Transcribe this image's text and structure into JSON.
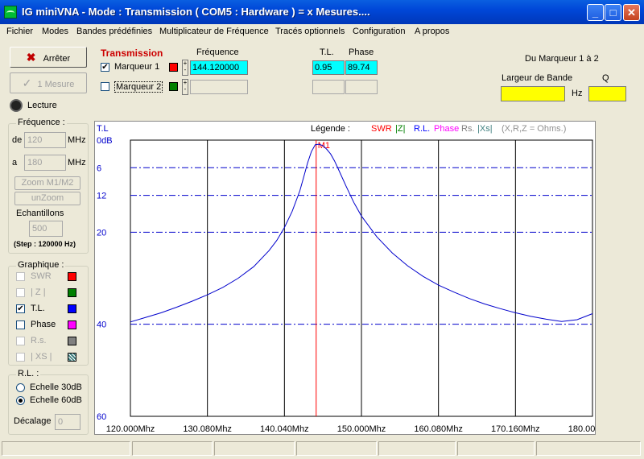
{
  "window": {
    "title": "IG miniVNA - Mode : Transmission ( COM5 :  Hardware ) = x Mesures....",
    "min": "_",
    "max": "□",
    "close": "✕"
  },
  "menu": [
    "Fichier",
    "Modes",
    "Bandes prédéfinies",
    "Multiplicateur de Fréquence",
    "Tracés optionnels",
    "Configuration",
    "A propos"
  ],
  "left": {
    "stop_label": "Arrêter",
    "one_measure_label": "1 Mesure",
    "read_label": "Lecture",
    "freq_group": "Fréquence :",
    "from_label": "de",
    "from_value": "120",
    "to_label": "a",
    "to_value": "180",
    "mhz": "MHz",
    "zoom_label": "Zoom M1/M2",
    "unzoom_label": "unZoom",
    "samples_label": "Echantillons",
    "samples_value": "500",
    "step_label": "(Step : 120000 Hz)",
    "graph_group": "Graphique :",
    "graphs": [
      {
        "label": "SWR",
        "checked": false,
        "enabled": false,
        "color": "#ff0000"
      },
      {
        "label": "| Z |",
        "checked": false,
        "enabled": false,
        "color": "#008000"
      },
      {
        "label": "T.L.",
        "checked": true,
        "enabled": true,
        "color": "#0000ff"
      },
      {
        "label": "Phase",
        "checked": false,
        "enabled": true,
        "color": "#ff00ff"
      },
      {
        "label": "R.s.",
        "checked": false,
        "enabled": false,
        "color": "#808080"
      },
      {
        "label": "| XS |",
        "checked": false,
        "enabled": false,
        "color": "#408080"
      }
    ],
    "rl_group": "R.L. :",
    "scale30": "Echelle 30dB",
    "scale60": "Echelle 60dB",
    "offset_label": "Décalage",
    "offset_value": "0"
  },
  "top": {
    "mode_title": "Transmission",
    "freq_header": "Fréquence",
    "tl_header": "T.L.",
    "phase_header": "Phase",
    "marker1_label": "Marqueur 1",
    "marker1_checked": true,
    "marker1_freq": "144.120000",
    "marker1_tl": "0.95",
    "marker1_phase": "89.74",
    "marker2_label": "Marqueur 2",
    "marker2_checked": false,
    "marker1_color": "#ff0000",
    "marker2_color": "#008000",
    "range_title": "Du Marqueur 1 à 2",
    "bandwidth_label": "Largeur de Bande",
    "hz_label": "Hz",
    "q_label": "Q",
    "spin_up": "+",
    "spin_down": "-"
  },
  "chart_data": {
    "type": "line",
    "ylabel": "T.L",
    "legend_label": "Légende :",
    "legend": [
      {
        "label": "SWR",
        "color": "#ff0000"
      },
      {
        "label": "|Z|",
        "color": "#008000"
      },
      {
        "label": "R.L.",
        "color": "#0000ff"
      },
      {
        "label": "Phase",
        "color": "#ff00ff"
      },
      {
        "label": "Rs.",
        "color": "#808080"
      },
      {
        "label": "|Xs|",
        "color": "#408080"
      },
      {
        "label": "(X,R,Z = Ohms.)",
        "color": "#909090"
      }
    ],
    "y_ticks": [
      {
        "label": "0dB",
        "value": 0
      },
      {
        "label": "6",
        "value": 6
      },
      {
        "label": "12",
        "value": 12
      },
      {
        "label": "20",
        "value": 20
      },
      {
        "label": "40",
        "value": 40
      },
      {
        "label": "60",
        "value": 60
      }
    ],
    "ylim": [
      0,
      60
    ],
    "x_ticks": [
      "120.000Mhz",
      "130.080Mhz",
      "140.040Mhz",
      "150.000Mhz",
      "160.080Mhz",
      "170.160Mhz",
      "180.000Mhz"
    ],
    "xlim": [
      120,
      180
    ],
    "grid": true,
    "marker": {
      "label": "M1",
      "x": 144.12,
      "color": "#ff0000"
    },
    "series": [
      {
        "color": "#0000cc",
        "x": [
          120,
          122,
          124,
          126,
          128,
          130,
          132,
          134,
          136,
          138,
          139,
          140,
          141,
          142,
          142.5,
          143,
          143.5,
          144,
          144.5,
          145,
          145.5,
          146,
          146.5,
          147,
          148,
          149,
          150,
          152,
          154,
          156,
          158,
          160,
          162,
          164,
          166,
          168,
          170,
          172,
          174,
          176,
          178,
          180
        ],
        "values": [
          39.5,
          38.5,
          37.5,
          36.3,
          35.0,
          33.6,
          32.0,
          30.0,
          27.5,
          24.0,
          21.8,
          19.0,
          15.5,
          11.0,
          8.0,
          5.0,
          2.5,
          1.0,
          0.9,
          1.2,
          2.0,
          3.0,
          4.5,
          6.3,
          10.0,
          13.5,
          16.5,
          21.0,
          24.5,
          27.3,
          29.6,
          31.5,
          33.0,
          34.4,
          35.6,
          36.6,
          37.5,
          38.3,
          38.9,
          39.4,
          39.0,
          37.7
        ]
      }
    ]
  }
}
